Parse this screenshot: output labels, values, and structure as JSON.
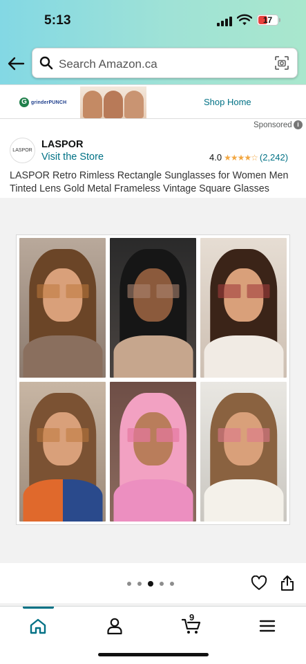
{
  "status_bar": {
    "time": "5:13",
    "battery": "17"
  },
  "search": {
    "placeholder": "Search Amazon.ca"
  },
  "ad": {
    "logo_text": "grinderPUNCH",
    "link": "Shop Home",
    "sponsored": "Sponsored"
  },
  "store": {
    "logo_text": "LASPOR",
    "brand": "LASPOR",
    "visit": "Visit the Store",
    "rating": "4.0",
    "stars": "★★★★☆",
    "review_count": "(2,242)"
  },
  "product": {
    "title": "LASPOR Retro Rimless Rectangle Sunglasses for Women Men Tinted Lens Gold Metal Frameless Vintage Square Glasses"
  },
  "gallery": {
    "image_count": 6,
    "active_index": 2,
    "dot_count": 5
  },
  "bottom_nav": {
    "cart_count": "9",
    "items": [
      "home-icon",
      "account-icon",
      "cart-icon",
      "menu-icon"
    ]
  },
  "colors": {
    "accent": "#007185",
    "star": "#f2a742",
    "header_start": "#83d8e4",
    "header_end": "#a9e7cd"
  }
}
